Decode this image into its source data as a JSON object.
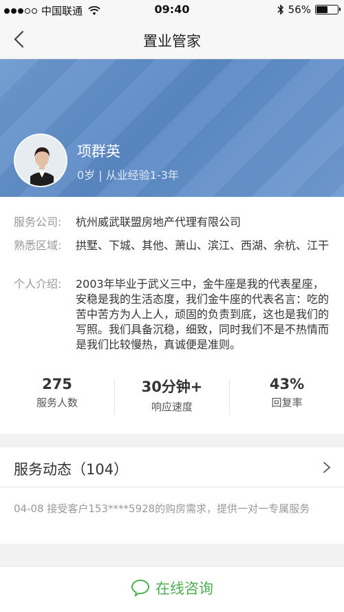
{
  "status_bar": {
    "carrier": "中国联通",
    "time": "09:40",
    "battery": "56%",
    "battery_level": 0.56
  },
  "nav": {
    "title": "置业管家"
  },
  "agent": {
    "name": "项群英",
    "subtitle": "0岁 | 从业经验1-3年"
  },
  "info": {
    "company_label": "服务公司:",
    "company_value": "杭州威武联盟房地产代理有限公司",
    "area_label": "熟悉区域:",
    "area_value": "拱墅、下城、其他、萧山、滨江、西湖、余杭、江干",
    "intro_label": "个人介绍:",
    "intro_value": "2003年毕业于武义三中，金牛座是我的代表星座，安稳是我的生活态度，我们金牛座的代表名言：吃的苦中苦方为人上人，顽固的负责到底，这也是我们的写照。我们具备沉稳，细致，同时我们不是不热情而是我们比较慢热，真诚便是准则。"
  },
  "stats": [
    {
      "value": "275",
      "label": "服务人数"
    },
    {
      "value": "30分钟+",
      "label": "响应速度"
    },
    {
      "value": "43%",
      "label": "回复率"
    }
  ],
  "dynamics": {
    "title": "服务动态（104）",
    "item": "04-08  接受客户153****5928的购房需求，提供一对一专属服务"
  },
  "bottom": {
    "consult_label": "在线咨询"
  },
  "colors": {
    "accent_green": "#4caf50",
    "hero_blue": "#5b88c4"
  }
}
